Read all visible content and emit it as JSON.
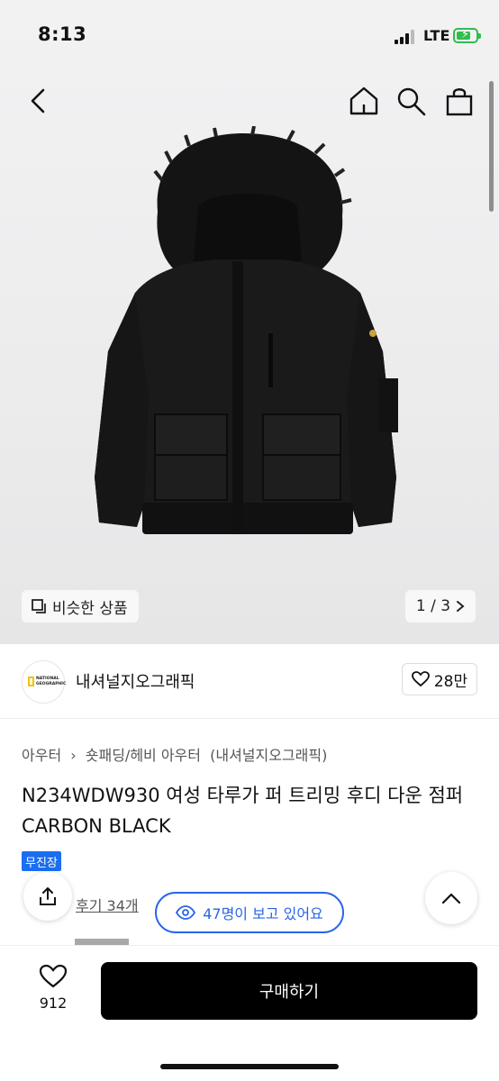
{
  "status_bar": {
    "time": "8:13",
    "network": "LTE",
    "battery_level": 0.75,
    "signal_bars": 3
  },
  "nav": {
    "back_icon": "chevron-left-icon",
    "home_icon": "home-icon",
    "search_icon": "search-icon",
    "bag_icon": "shopping-bag-icon"
  },
  "gallery": {
    "similar_label": "비슷한 상품",
    "page_indicator": "1 / 3",
    "image": "black hooded down jacket with fur trim"
  },
  "brand": {
    "name": "내셔널지오그래픽",
    "logo_text": "NATIONAL\nGEOGRAPHIC",
    "like_count": "28만"
  },
  "product": {
    "breadcrumb": [
      "아우터",
      "›",
      "숏패딩/헤비 아우터",
      "(내셔널지오그래픽)"
    ],
    "title": "N234WDW930 여성 타루가 퍼 트리밍 후디 다운 점퍼 CARBON BLACK",
    "badge": "무진장",
    "review_link": "후기 34개",
    "viewers_text": "47명이 보고 있어요"
  },
  "bottom": {
    "wish_count": "912",
    "buy_label": "구매하기"
  },
  "colors": {
    "accent_blue": "#2a64e8",
    "badge_blue": "#1a6ef0",
    "battery_green": "#2fbd4f",
    "buy_button": "#000000"
  }
}
